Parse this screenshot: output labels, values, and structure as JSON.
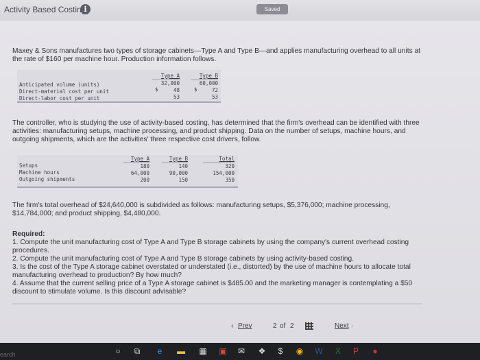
{
  "header": {
    "title": "Activity Based Costing",
    "saved_label": "Saved"
  },
  "intro": {
    "line1": "Maxey & Sons manufactures two types of storage cabinets—Type A and Type B—and applies manufacturing overhead to all units at",
    "line2": "the rate of $160 per machine hour. Production information follows."
  },
  "table1": {
    "headers": [
      "Type A",
      "Type B"
    ],
    "rows": [
      {
        "label": "Anticipated volume (units)",
        "a": "32,000",
        "b": "60,000"
      },
      {
        "label": "Direct-material cost per unit",
        "a": "48",
        "b": "72"
      },
      {
        "label": "Direct-labor cost per unit",
        "a": "53",
        "b": "53"
      }
    ],
    "currency": "$"
  },
  "para2": {
    "line1": "The controller, who is studying the use of activity-based costing, has determined that the firm's overhead can be identified with three",
    "line2": "activities: manufacturing setups, machine processing, and product shipping. Data on the number of setups, machine hours, and",
    "line3": "outgoing shipments, which are the activities' three respective cost drivers, follow."
  },
  "table2": {
    "headers": [
      "Type A",
      "Type B",
      "Total"
    ],
    "rows": [
      {
        "label": "Setups",
        "a": "180",
        "b": "140",
        "total": "320"
      },
      {
        "label": "Machine hours",
        "a": "64,000",
        "b": "90,000",
        "total": "154,000"
      },
      {
        "label": "Outgoing shipments",
        "a": "200",
        "b": "150",
        "total": "350"
      }
    ]
  },
  "para3": {
    "line1": "The firm's total overhead of $24,640,000 is subdivided as follows: manufacturing setups, $5,376,000; machine processing,",
    "line2": "$14,784,000; and product shipping, $4,480,000."
  },
  "required": {
    "heading": "Required:",
    "lines": [
      "1. Compute the unit manufacturing cost of Type A and Type B storage cabinets by using the company's current overhead costing",
      "procedures.",
      "2. Compute the unit manufacturing cost of Type A and Type B storage cabinets by using activity-based costing.",
      "3. Is the cost of the Type A storage cabinet overstated or understated (i.e., distorted) by the use of machine hours to allocate total",
      "manufacturing overhead to production? By how much?",
      "4. Assume that the current selling price of a Type A storage cabinet is $485.00 and the marketing manager is contemplating a $50",
      "discount to stimulate volume. Is this discount advisable?"
    ]
  },
  "nav": {
    "prev": "Prev",
    "page_current": "2",
    "page_of": "of",
    "page_total": "2",
    "next": "Next"
  },
  "taskbar": {
    "search_text": "earch"
  },
  "icons": [
    "info-icon",
    "grid-icon",
    "chevron-left-icon",
    "chevron-right-icon",
    "cursor-icon"
  ]
}
